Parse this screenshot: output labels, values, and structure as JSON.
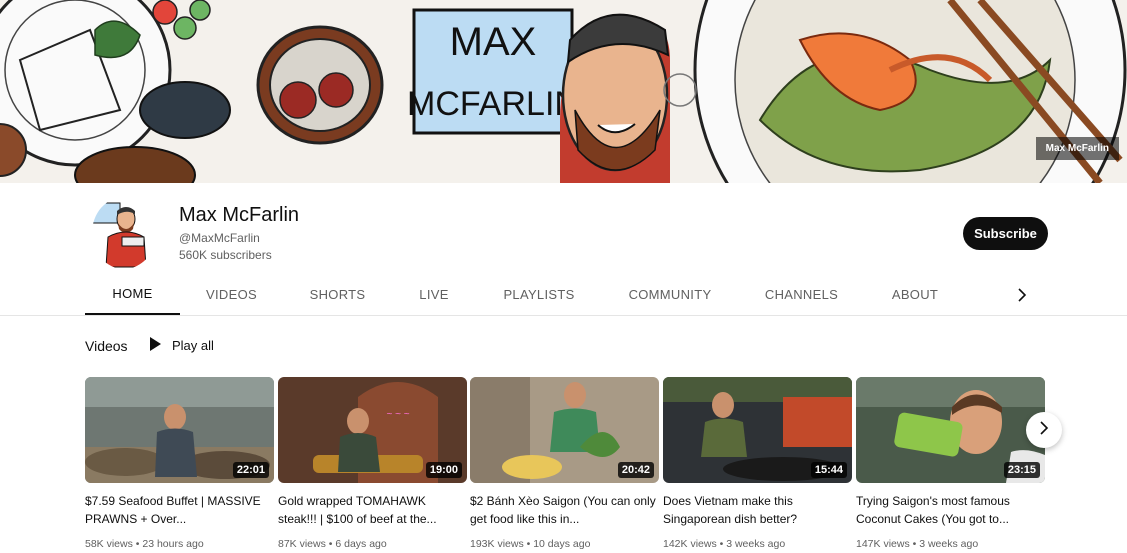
{
  "banner": {
    "watermark": "Max McFarlin",
    "logo_line1": "MAX",
    "logo_line2": "MCFARLIN"
  },
  "channel": {
    "name": "Max McFarlin",
    "handle": "@MaxMcFarlin",
    "subscribers": "560K subscribers",
    "subscribe_label": "Subscribe"
  },
  "tabs": [
    {
      "label": "HOME",
      "active": true
    },
    {
      "label": "VIDEOS",
      "active": false
    },
    {
      "label": "SHORTS",
      "active": false
    },
    {
      "label": "LIVE",
      "active": false
    },
    {
      "label": "PLAYLISTS",
      "active": false
    },
    {
      "label": "COMMUNITY",
      "active": false
    },
    {
      "label": "CHANNELS",
      "active": false
    },
    {
      "label": "ABOUT",
      "active": false
    }
  ],
  "section": {
    "title": "Videos",
    "play_all": "Play all"
  },
  "videos": [
    {
      "title": "$7.59 Seafood Buffet | MASSIVE PRAWNS + Over...",
      "duration": "22:01",
      "meta": "58K views • 23 hours ago"
    },
    {
      "title": "Gold wrapped TOMAHAWK steak!!! | $100 of beef at the...",
      "duration": "19:00",
      "meta": "87K views • 6 days ago"
    },
    {
      "title": "$2 Bánh Xèo Saigon (You can only get food like this in...",
      "duration": "20:42",
      "meta": "193K views • 10 days ago"
    },
    {
      "title": "Does Vietnam make this Singaporean dish better?",
      "duration": "15:44",
      "meta": "142K views • 3 weeks ago"
    },
    {
      "title": "Trying Saigon's most famous Coconut Cakes (You got to...",
      "duration": "23:15",
      "meta": "147K views • 3 weeks ago"
    }
  ],
  "colors": {
    "subscribe_bg": "#0f0f0f",
    "text_secondary": "#606060",
    "banner_blue": "#bcdcf3"
  }
}
